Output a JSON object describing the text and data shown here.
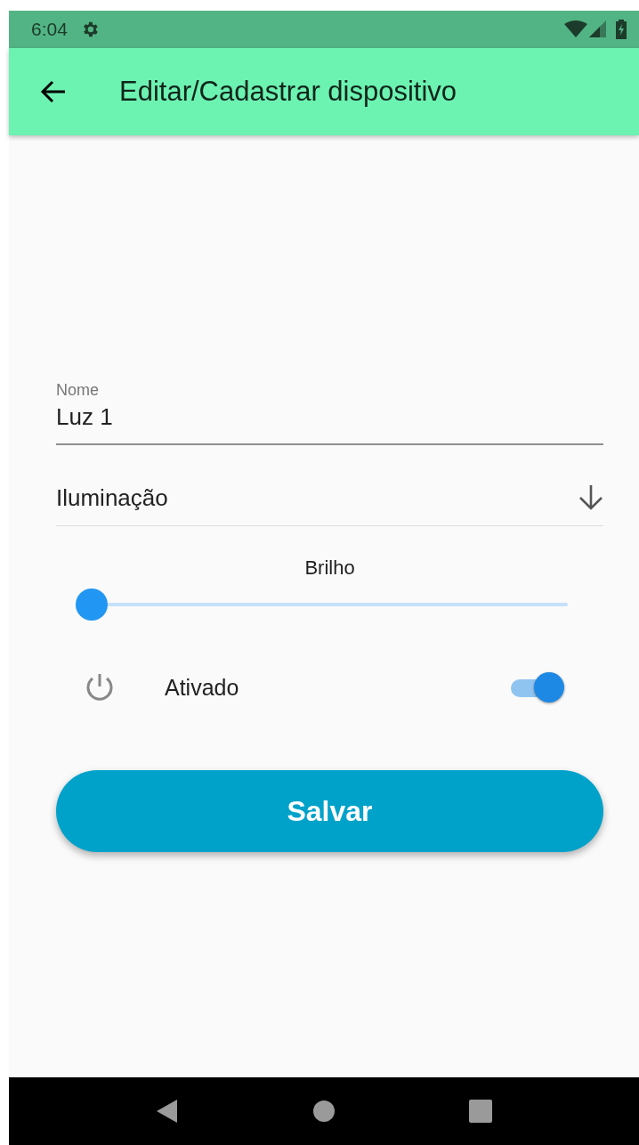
{
  "status_bar": {
    "time": "6:04"
  },
  "app_bar": {
    "title": "Editar/Cadastrar dispositivo"
  },
  "form": {
    "name_field": {
      "label": "Nome",
      "value": "Luz 1"
    },
    "type_dropdown": {
      "value": "Iluminação"
    },
    "brightness": {
      "label": "Brilho",
      "level": 0
    },
    "active": {
      "label": "Ativado",
      "on": true
    },
    "save_button": {
      "label": "Salvar"
    }
  }
}
